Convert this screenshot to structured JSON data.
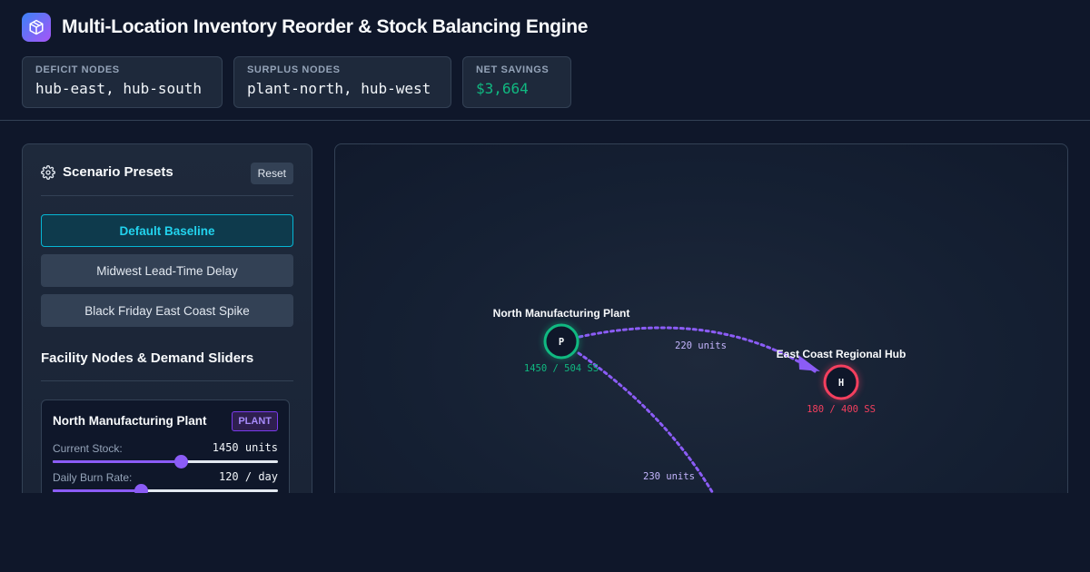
{
  "app": {
    "title": "Multi-Location Inventory Reorder & Stock Balancing Engine",
    "logo_icon": "package-icon"
  },
  "stats": [
    {
      "label": "DEFICIT NODES",
      "value": "hub-east, hub-south"
    },
    {
      "label": "SURPLUS NODES",
      "value": "plant-north, hub-west"
    },
    {
      "label": "NET SAVINGS",
      "value": "$3,664",
      "color": "#10b981"
    }
  ],
  "sidebar": {
    "presets_title": "Scenario Presets",
    "presets_icon": "gear-icon",
    "reset_label": "Reset",
    "presets": [
      {
        "label": "Default Baseline",
        "active": true
      },
      {
        "label": "Midwest Lead-Time Delay",
        "active": false
      },
      {
        "label": "Black Friday East Coast Spike",
        "active": false
      }
    ],
    "nodes_title": "Facility Nodes & Demand Sliders",
    "node_card": {
      "name": "North Manufacturing Plant",
      "badge": "PLANT",
      "stock_label": "Current Stock:",
      "stock_value": "1450 units",
      "stock_fraction": 0.57,
      "burn_label": "Daily Burn Rate:",
      "burn_value": "120 / day",
      "burn_fraction": 0.39
    }
  },
  "map": {
    "nodes": [
      {
        "id": "plant-north",
        "letter": "P",
        "name": "North Manufacturing Plant",
        "stock_text": "1450 / 504 SS",
        "color": "#10b981"
      },
      {
        "id": "hub-east",
        "letter": "H",
        "name": "East Coast Regional Hub",
        "stock_text": "180 / 400 SS",
        "color": "#f43f5e"
      }
    ],
    "flows": [
      {
        "label": "220 units",
        "color": "#8b5cf6"
      },
      {
        "label": "230 units",
        "color": "#8b5cf6"
      }
    ]
  }
}
